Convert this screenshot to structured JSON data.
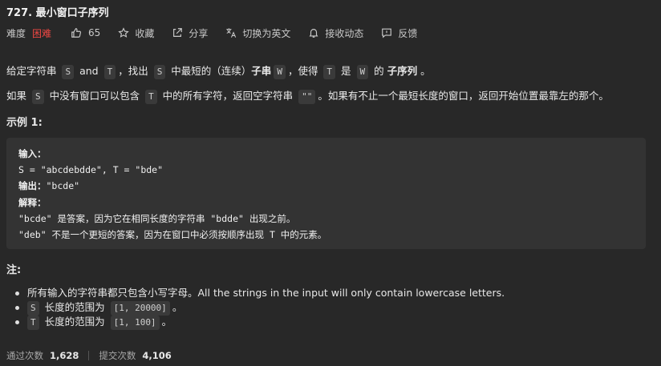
{
  "problem": {
    "title": "727. 最小窗口子序列"
  },
  "toolbar": {
    "difficulty_label": "难度",
    "difficulty_value": "困难",
    "likes": "65",
    "favorite": "收藏",
    "share": "分享",
    "switch_lang": "切换为英文",
    "subscribe": "接收动态",
    "feedback": "反馈"
  },
  "colors": {
    "background": "#282828",
    "difficulty_hard": "#ef4743",
    "code_block": "#333333"
  },
  "description": {
    "p1_a": "给定字符串 ",
    "p1_S": "S",
    "p1_and": " and ",
    "p1_T": "T",
    "p1_b": "，找出 ",
    "p1_S2": "S",
    "p1_c": " 中最短的（连续）",
    "p1_sub": "子串",
    "p1_W": "W",
    "p1_d": "，使得 ",
    "p1_T2": "T",
    "p1_e": " 是 ",
    "p1_W2": "W",
    "p1_f": " 的 ",
    "p1_subseq": "子序列",
    "p1_g": " 。",
    "p2_a": "如果 ",
    "p2_S": "S",
    "p2_b": " 中没有窗口可以包含 ",
    "p2_T": "T",
    "p2_c": " 中的所有字符，返回空字符串 ",
    "p2_empty": "\"\"",
    "p2_d": "。如果有不止一个最短长度的窗口，返回开始位置最靠左的那个。"
  },
  "example": {
    "title": "示例 1:",
    "input_label": "输入：",
    "input_value": "S = \"abcdebdde\", T = \"bde\"",
    "output_label": "输出：",
    "output_value": "\"bcde\"",
    "explain_label": "解释：",
    "explain_1": "\"bcde\" 是答案，因为它在相同长度的字符串 \"bdde\" 出现之前。",
    "explain_2": "\"deb\" 不是一个更短的答案，因为在窗口中必须按顺序出现 T 中的元素。"
  },
  "notes": {
    "title": "注:",
    "n1": "所有输入的字符串都只包含小写字母。All the strings in the input will only contain lowercase letters.",
    "n2_var": "S",
    "n2_text": " 长度的范围为 ",
    "n2_range": "[1, 20000]",
    "n2_end": "。",
    "n3_var": "T",
    "n3_text": " 长度的范围为 ",
    "n3_range": "[1, 100]",
    "n3_end": "。"
  },
  "stats": {
    "accepted_label": "通过次数",
    "accepted_value": "1,628",
    "submitted_label": "提交次数",
    "submitted_value": "4,106"
  },
  "icons": [
    "thumbs-up-icon",
    "star-icon",
    "share-icon",
    "translate-icon",
    "bell-icon",
    "feedback-icon"
  ]
}
